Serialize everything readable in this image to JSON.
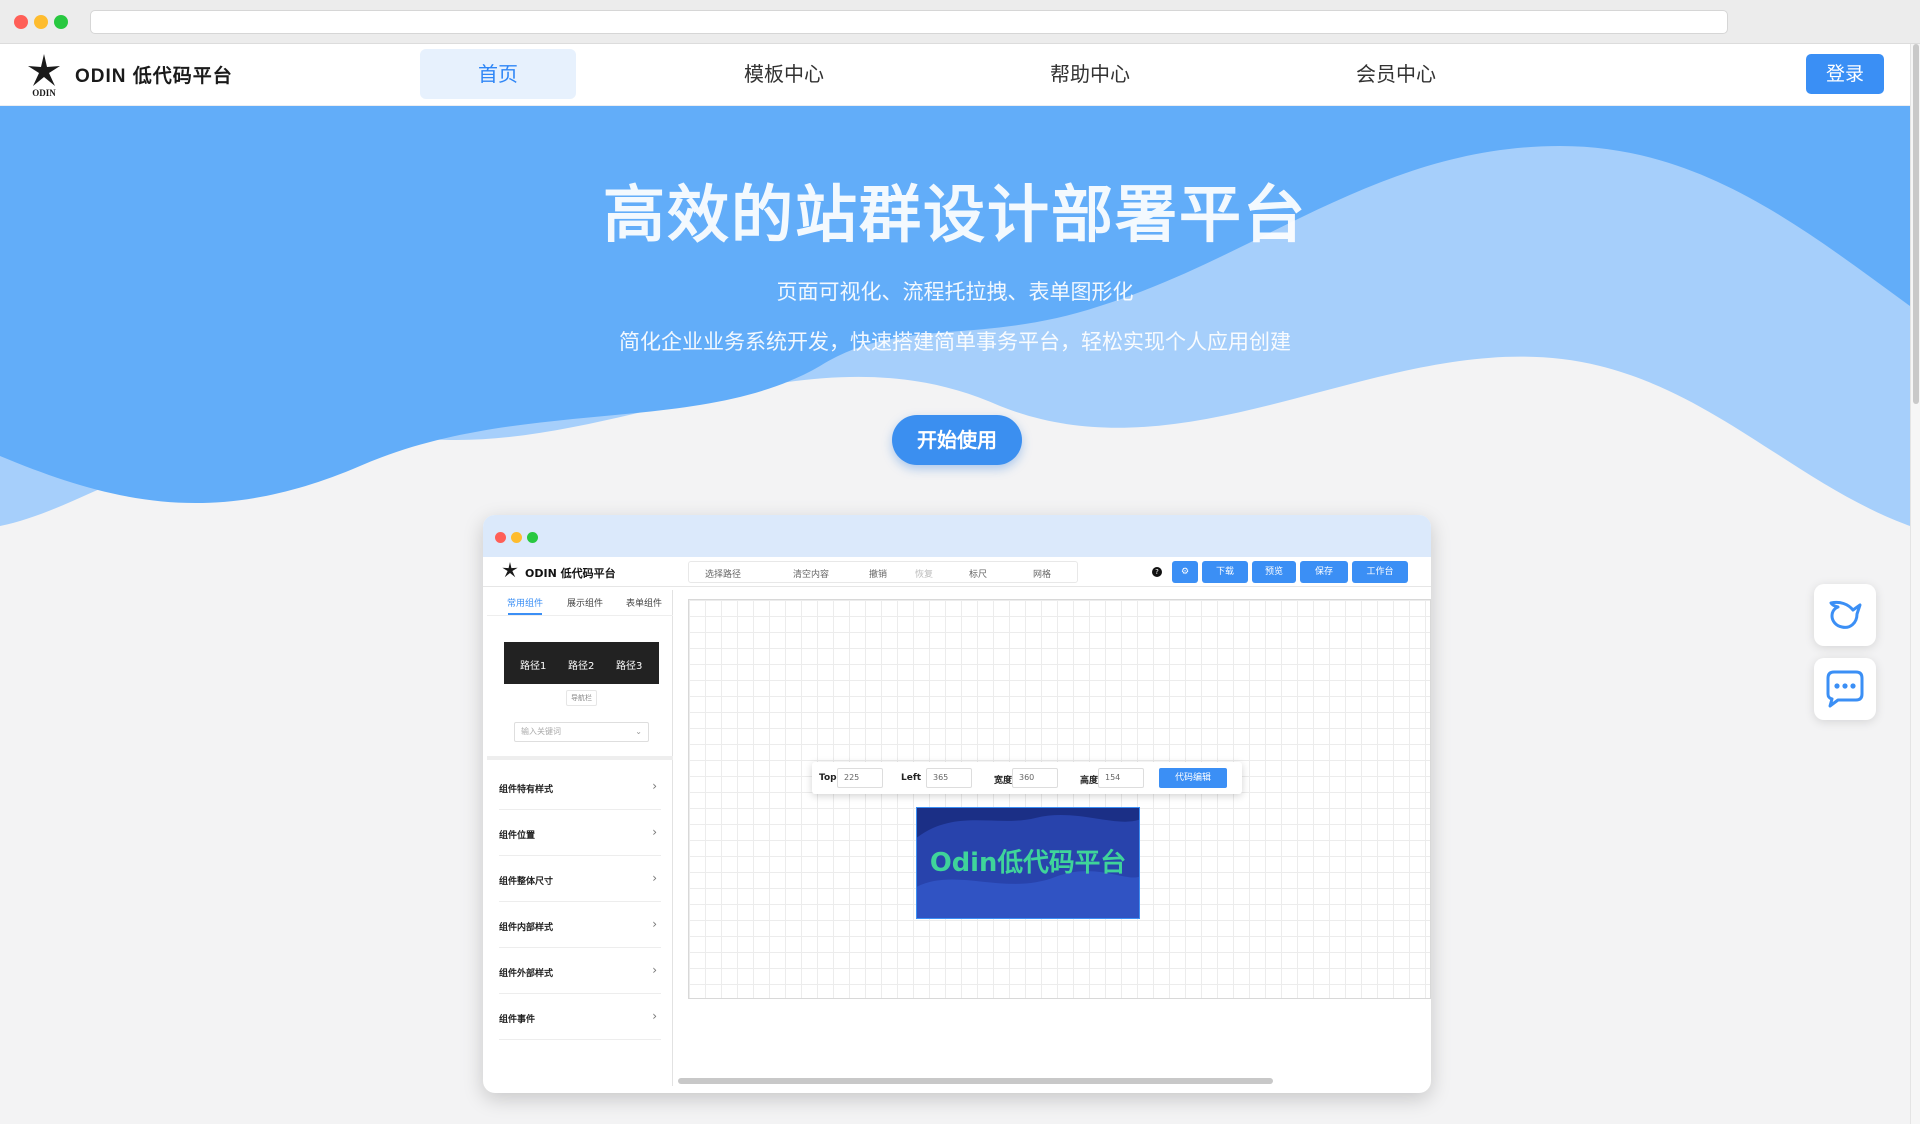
{
  "brand": {
    "name": "ODIN 低代码平台",
    "logo_word": "ODIN"
  },
  "nav": {
    "items": [
      {
        "label": "首页",
        "active": true
      },
      {
        "label": "模板中心",
        "active": false
      },
      {
        "label": "帮助中心",
        "active": false
      },
      {
        "label": "会员中心",
        "active": false
      }
    ],
    "login_label": "登录"
  },
  "hero": {
    "title": "高效的站群设计部署平台",
    "subtitle_1": "页面可视化、流程托拉拽、表单图形化",
    "subtitle_2": "简化企业业务系统开发，快速搭建简单事务平台，轻松实现个人应用创建",
    "cta_label": "开始使用"
  },
  "floating": {
    "icons": [
      "bird-icon",
      "chat-icon"
    ]
  },
  "mock": {
    "brand": "ODIN 低代码平台",
    "tools": [
      "选择路径",
      "清空内容",
      "撤销",
      "恢复",
      "标尺",
      "网格"
    ],
    "actions": [
      "下载",
      "预览",
      "保存",
      "工作台"
    ],
    "help_glyph": "?",
    "tabs": [
      "常用组件",
      "展示组件",
      "表单组件"
    ],
    "navbar_preview": [
      "路径1",
      "路径2",
      "路径3"
    ],
    "navbar_caption": "导航栏",
    "keyword_placeholder": "输入关键词",
    "props": [
      "组件特有样式",
      "组件位置",
      "组件整体尺寸",
      "组件内部样式",
      "组件外部样式",
      "组件事件"
    ],
    "position": {
      "top_label": "Top",
      "top_value": "225",
      "left_label": "Left",
      "left_value": "365",
      "width_label": "宽度",
      "width_value": "360",
      "height_label": "高度",
      "height_value": "154",
      "code_button": "代码编辑"
    },
    "banner_text": "Odin低代码平台"
  },
  "colors": {
    "accent": "#3b8ff5",
    "hero_blue": "#62adf9",
    "hero_light": "#a6cffb",
    "banner_dark": "#1b2f86",
    "banner_text": "#3fd49a"
  }
}
